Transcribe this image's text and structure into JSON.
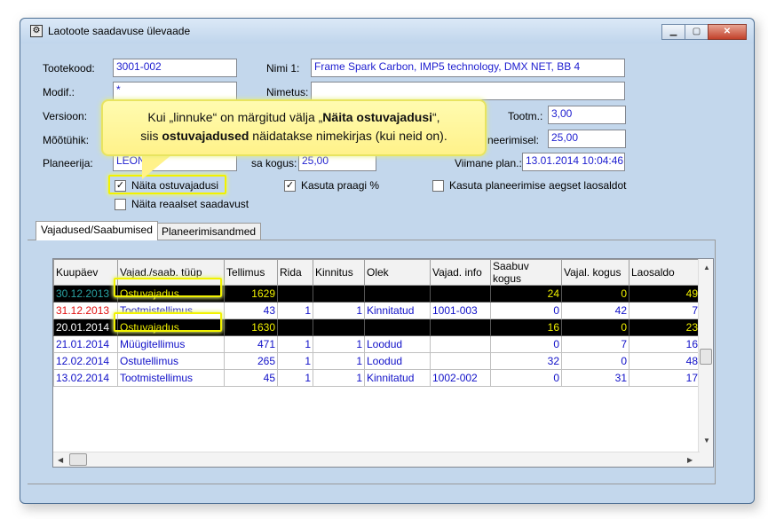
{
  "window": {
    "title": "Laotoote saadavuse ülevaade",
    "min_icon": "minimize-icon",
    "max_icon": "maximize-icon",
    "close_icon": "close-icon"
  },
  "fields": {
    "tootekood": {
      "label": "Tootekood:",
      "value": "3001-002"
    },
    "nimi1": {
      "label": "Nimi 1:",
      "value": "Frame Spark Carbon, IMP5 technology, DMX NET, BB 4"
    },
    "modif": {
      "label": "Modif.:",
      "value": "*"
    },
    "nimetus": {
      "label": "Nimetus:",
      "value": ""
    },
    "versioon": {
      "label": "Versioon:"
    },
    "tootm": {
      "label": "Tootm.:",
      "value": "3,00"
    },
    "mootuhik": {
      "label": "Mõõtühik:"
    },
    "planeerimisel": {
      "label": "neerimisel:",
      "value": "25,00"
    },
    "planeerija": {
      "label": "Planeerija:",
      "value": "LEONID"
    },
    "kogus": {
      "label": "sa kogus:",
      "value": "25,00"
    },
    "viimane": {
      "label": "Viimane plan.:",
      "value": "13.01.2014 10:04:46"
    }
  },
  "checkboxes": {
    "naita_ostuvajadusi": {
      "label": "Näita ostuvajadusi",
      "checked": true
    },
    "naita_reaalset": {
      "label": "Näita reaalset saadavust",
      "checked": false
    },
    "kasuta_praagi": {
      "label": "Kasuta praagi %",
      "checked": true
    },
    "kasuta_planeerimise": {
      "label": "Kasuta planeerimise aegset laosaldot",
      "checked": false
    }
  },
  "tabs": [
    "Vajadused/Saabumised",
    "Planeerimisandmed"
  ],
  "callout": {
    "line1_a": "Kui „linnuke“ on märgitud välja „",
    "line1_b": "Näita ostuvajadusi",
    "line1_c": "“,",
    "line2_a": "siis ",
    "line2_b": "ostuvajadused",
    "line2_c": " näidatakse nimekirjas (kui neid on)."
  },
  "table": {
    "columns": [
      "Kuupäev",
      "Vajad./saab. tüüp",
      "Tellimus",
      "Rida",
      "Kinnitus",
      "Olek",
      "Vajad. info",
      "Saabuv kogus",
      "Vajal. kogus",
      "Laosaldo"
    ],
    "rows": [
      {
        "style": "black",
        "date_color": "#2aa4a4",
        "cells": [
          "30.12.2013",
          "Ostuvajadus",
          "1629",
          "",
          "",
          "",
          "",
          "24",
          "0",
          "49"
        ]
      },
      {
        "style": "red",
        "cells": [
          "31.12.2013",
          "Tootmistellimus",
          "43",
          "1",
          "1",
          "Kinnitatud",
          "1001-003",
          "0",
          "42",
          "7"
        ]
      },
      {
        "style": "black",
        "date_color": "#ffffff",
        "cells": [
          "20.01.2014",
          "Ostuvajadus",
          "1630",
          "",
          "",
          "",
          "",
          "16",
          "0",
          "23"
        ]
      },
      {
        "style": "blue",
        "cells": [
          "21.01.2014",
          "Müügitellimus",
          "471",
          "1",
          "1",
          "Loodud",
          "",
          "0",
          "7",
          "16"
        ]
      },
      {
        "style": "blue",
        "cells": [
          "12.02.2014",
          "Ostutellimus",
          "265",
          "1",
          "1",
          "Loodud",
          "",
          "32",
          "0",
          "48"
        ]
      },
      {
        "style": "blue",
        "cells": [
          "13.02.2014",
          "Tootmistellimus",
          "45",
          "1",
          "1",
          "Kinnitatud",
          "1002-002",
          "0",
          "31",
          "17"
        ]
      }
    ]
  },
  "colors": {
    "accent_yellow": "#f2f200",
    "red_text": "#e01010",
    "blue_text": "#1010c8",
    "black_row_text": "#f0f000"
  }
}
